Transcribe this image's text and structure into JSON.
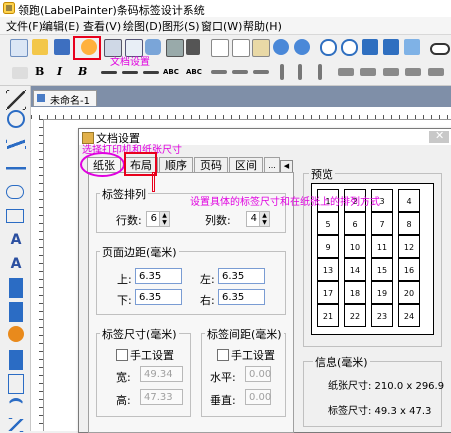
{
  "window": {
    "title": "领跑(LabelPainter)条码标签设计系统"
  },
  "menubar": {
    "items": [
      "文件(F)",
      "编辑(E)",
      "查看(V)",
      "绘图(D)",
      "图形(S)",
      "窗口(W)",
      "帮助(H)"
    ]
  },
  "toolbar2": {
    "bold": "B",
    "italic": "I",
    "bold_italic": "B",
    "abc_small": "ABC",
    "abc": "ABC"
  },
  "document": {
    "tab_label": "未命名-1"
  },
  "dialog": {
    "title": "文档设置",
    "tabs": [
      "纸张",
      "布局",
      "顺序",
      "页码",
      "区间",
      "..."
    ],
    "label_arrangement": {
      "group_title": "标签排列",
      "rows_label": "行数:",
      "rows_value": "6",
      "cols_label": "列数:",
      "cols_value": "4"
    },
    "margins": {
      "group_title": "页面边距(毫米)",
      "top_label": "上:",
      "top_value": "6.35",
      "left_label": "左:",
      "left_value": "6.35",
      "bottom_label": "下:",
      "bottom_value": "6.35",
      "right_label": "右:",
      "right_value": "6.35"
    },
    "label_size": {
      "group_title": "标签尺寸(毫米)",
      "manual_label": "手工设置",
      "width_label": "宽:",
      "width_value": "49.34",
      "height_label": "高:",
      "height_value": "47.33"
    },
    "label_spacing": {
      "group_title": "标签间距(毫米)",
      "manual_label": "手工设置",
      "horizontal_label": "水平:",
      "horizontal_value": "0.00",
      "vertical_label": "垂直:",
      "vertical_value": "0.00"
    },
    "preview": {
      "title": "预览",
      "cells": [
        "1",
        "2",
        "3",
        "4",
        "5",
        "6",
        "7",
        "8",
        "9",
        "10",
        "11",
        "12",
        "13",
        "14",
        "15",
        "16",
        "17",
        "18",
        "19",
        "20",
        "21",
        "22",
        "23",
        "24"
      ]
    },
    "info": {
      "group_title": "信息(毫米)",
      "paper_size": "纸张尺寸: 210.0 x 296.9",
      "label_size": "标签尺寸: 49.3 x 47.3"
    }
  },
  "annotations": {
    "doc_settings": "文档设置",
    "select_printer": "选择打印机和纸张尺寸",
    "set_layout": "设置具体的标签尺寸和在纸张上的排列方式"
  },
  "colors": {
    "annotation": "#e000e0",
    "highlight_box": "#e8001c",
    "canvas": "#7f8fa8"
  }
}
